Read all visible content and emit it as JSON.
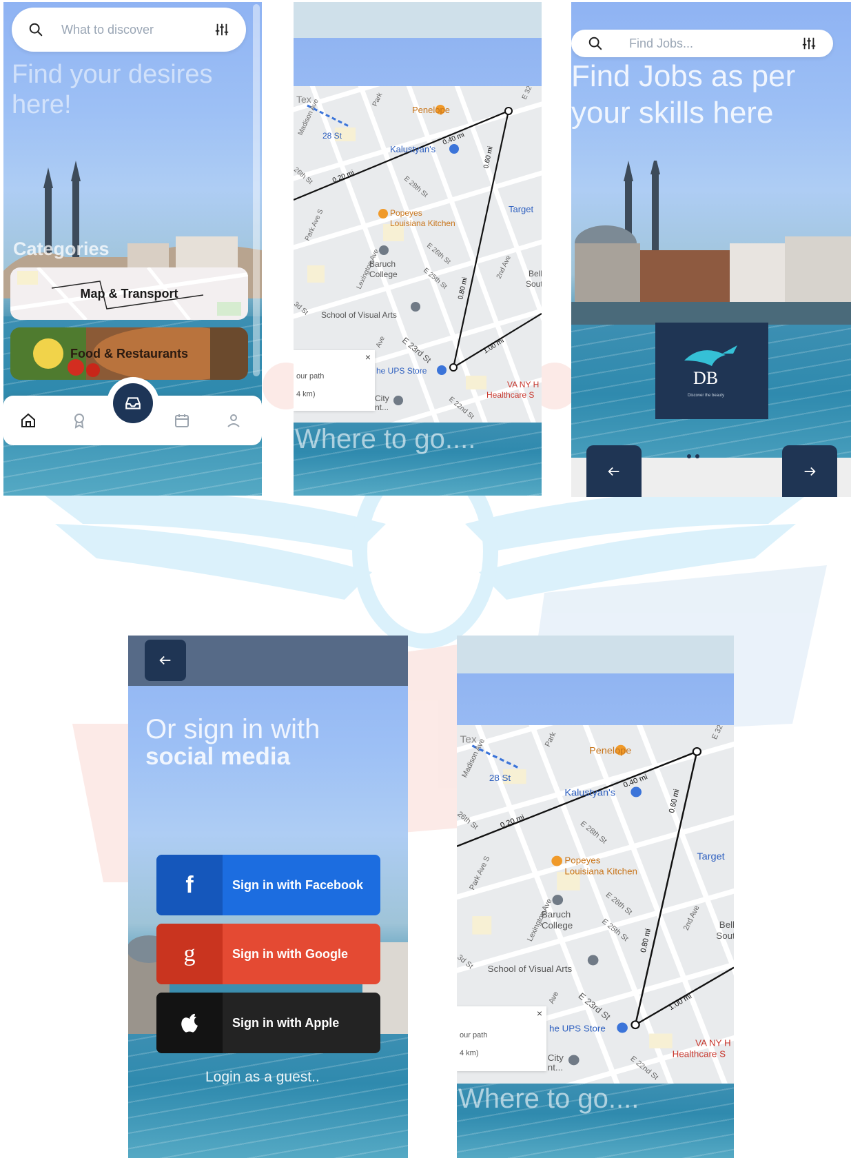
{
  "watermark": {
    "primary_color": "#5ec4f0",
    "secondary_color": "#f0a090"
  },
  "discover_screen": {
    "search": {
      "placeholder": "What to discover",
      "icon": "search-icon",
      "filter_icon": "sliders-icon"
    },
    "hero_text": "Find your desires here!",
    "categories_title": "Categories",
    "cards": [
      {
        "label": "Map & Transport"
      },
      {
        "label": "Food & Restaurants"
      }
    ],
    "tabs": [
      "home-icon",
      "award-icon",
      "inbox-icon",
      "calendar-icon",
      "user-icon"
    ],
    "accent_color": "#1d3557"
  },
  "map_screen": {
    "labels": {
      "penelope": "Penelope",
      "kalustyans": "Kalustyan's",
      "st28": "28 St",
      "madison": "Madison Ave",
      "park": "Park",
      "e32": "E 32",
      "e28": "E 28th St",
      "st26": "26th St",
      "popeyes1": "Popeyes",
      "popeyes2": "Louisiana Kitchen",
      "target": "Target",
      "parkaves": "Park Ave S",
      "lexington": "Lexington Ave",
      "baruch1": "Baruch",
      "baruch2": "College",
      "e26": "E 26th St",
      "e25": "E 25th St",
      "ave2": "2nd Ave",
      "bell1": "Bell",
      "bell2": "Sout",
      "st3": "3d St",
      "svarts": "School of Visual Arts",
      "e23": "E 23rd St",
      "ups": "he UPS Store",
      "city1": "City",
      "city2": "nt...",
      "vany1": "VA NY H",
      "vany2": "Healthcare S",
      "e22": "E 22nd St",
      "ave": "Ave",
      "tex": "Tex"
    },
    "distances": [
      "0.20 mi",
      "0.40 mi",
      "0.60 mi",
      "0.80 mi",
      "1.00 mi"
    ],
    "path_panel": {
      "line1": "our path",
      "line2": "4 km)",
      "close": "×"
    },
    "footer_text": "Where to go...."
  },
  "jobs_screen": {
    "search": {
      "placeholder": "Find Jobs...",
      "icon": "search-icon",
      "filter_icon": "sliders-icon"
    },
    "hero_text": "Find Jobs as per your skills here",
    "logo": {
      "initials": "DB",
      "tagline": "Discover the beauty"
    },
    "prev_icon": "arrow-left-icon",
    "next_icon": "arrow-right-icon"
  },
  "signin_screen": {
    "title_line1": "Or sign in with",
    "title_line2": "social media",
    "buttons": [
      {
        "icon_glyph": "f",
        "label": "Sign in with Facebook",
        "color": "#1c6de0"
      },
      {
        "icon_glyph": "g",
        "label": "Sign in with Google",
        "color": "#e44a33"
      },
      {
        "icon_glyph": "",
        "label": "Sign in with Apple",
        "color": "#232323"
      }
    ],
    "guest_link": "Login as a guest..",
    "back_icon": "arrow-left-icon"
  }
}
